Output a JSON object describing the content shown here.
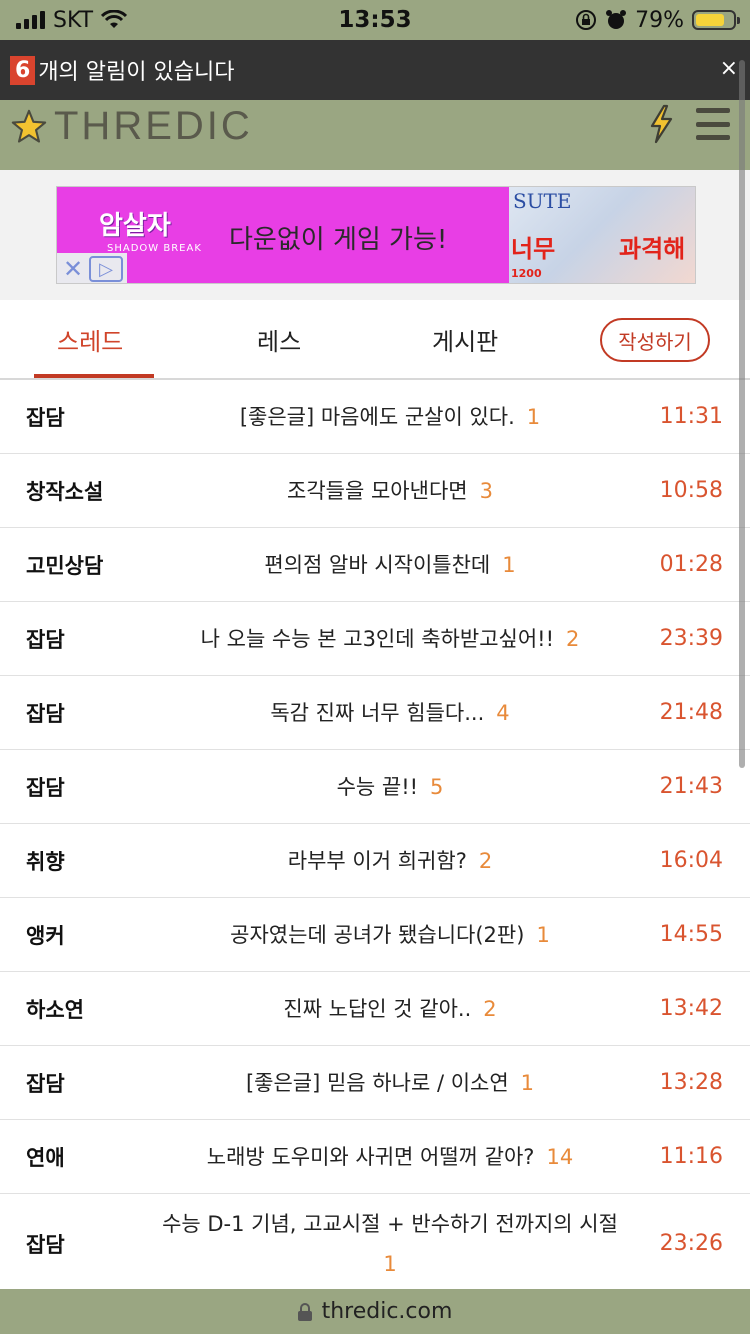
{
  "status_bar": {
    "carrier": "SKT",
    "time": "13:53",
    "battery": "79%"
  },
  "notification": {
    "count": "6",
    "text": "개의 알림이 있습니다",
    "close": "×"
  },
  "header": {
    "logo": "THREDIC",
    "colors": {
      "bg": "#9aa682",
      "accent": "#d0442a"
    }
  },
  "ad": {
    "logo": "암살자",
    "game": "SHADOW BREAK",
    "headline": "다운없이 게임 가능!",
    "right_title": "SUTE",
    "right_red1": "너무",
    "right_red2": "과격해",
    "right_small": "1200"
  },
  "tabs": [
    {
      "label": "스레드",
      "active": true
    },
    {
      "label": "레스",
      "active": false
    },
    {
      "label": "게시판",
      "active": false
    }
  ],
  "write_button": "작성하기",
  "threads": [
    {
      "category": "잡담",
      "title": "[좋은글] 마음에도 군살이 있다.",
      "count": "1",
      "time": "11:31"
    },
    {
      "category": "창작소설",
      "title": "조각들을 모아낸다면",
      "count": "3",
      "time": "10:58"
    },
    {
      "category": "고민상담",
      "title": "편의점 알바 시작이틀찬데",
      "count": "1",
      "time": "01:28"
    },
    {
      "category": "잡담",
      "title": "나 오늘 수능 본 고3인데 축하받고싶어!!",
      "count": "2",
      "time": "23:39"
    },
    {
      "category": "잡담",
      "title": "독감 진짜 너무 힘들다...",
      "count": "4",
      "time": "21:48"
    },
    {
      "category": "잡담",
      "title": "수능 끝!!",
      "count": "5",
      "time": "21:43"
    },
    {
      "category": "취향",
      "title": "라부부 이거 희귀함?",
      "count": "2",
      "time": "16:04"
    },
    {
      "category": "앵커",
      "title": "공자였는데 공녀가 됐습니다(2판)",
      "count": "1",
      "time": "14:55"
    },
    {
      "category": "하소연",
      "title": "진짜 노답인 것 같아..",
      "count": "2",
      "time": "13:42"
    },
    {
      "category": "잡담",
      "title": "[좋은글] 믿음 하나로 / 이소연",
      "count": "1",
      "time": "13:28"
    },
    {
      "category": "연애",
      "title": "노래방 도우미와 사귀면 어떨꺼 같아?",
      "count": "14",
      "time": "11:16"
    },
    {
      "category": "잡담",
      "title": "수능 D-1 기념, 고교시절 + 반수하기 전까지의 시절",
      "count": "1",
      "time": "23:26"
    }
  ],
  "url": "thredic.com"
}
